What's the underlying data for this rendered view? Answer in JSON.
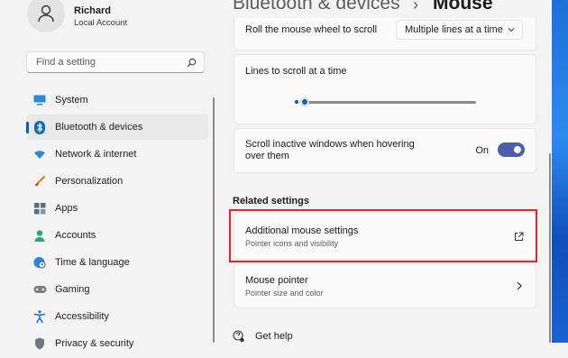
{
  "user": {
    "name": "Richard",
    "account_type": "Local Account"
  },
  "search": {
    "placeholder": "Find a setting",
    "icon": "search-icon"
  },
  "nav": [
    {
      "label": "System",
      "icon": "monitor-icon",
      "active": false
    },
    {
      "label": "Bluetooth & devices",
      "icon": "bluetooth-icon",
      "active": true
    },
    {
      "label": "Network & internet",
      "icon": "wifi-icon",
      "active": false
    },
    {
      "label": "Personalization",
      "icon": "brush-icon",
      "active": false
    },
    {
      "label": "Apps",
      "icon": "apps-icon",
      "active": false
    },
    {
      "label": "Accounts",
      "icon": "person-icon",
      "active": false
    },
    {
      "label": "Time & language",
      "icon": "globe-clock-icon",
      "active": false
    },
    {
      "label": "Gaming",
      "icon": "gamepad-icon",
      "active": false
    },
    {
      "label": "Accessibility",
      "icon": "accessibility-icon",
      "active": false
    },
    {
      "label": "Privacy & security",
      "icon": "shield-icon",
      "active": false
    }
  ],
  "breadcrumb": {
    "parent": "Bluetooth & devices",
    "separator": "›",
    "current": "Mouse"
  },
  "settings": {
    "scroll_wheel": {
      "label": "Roll the mouse wheel to scroll",
      "value": "Multiple lines at a time"
    },
    "lines_to_scroll": {
      "label": "Lines to scroll at a time",
      "level_fraction": 0.03
    },
    "scroll_inactive": {
      "label_line1": "Scroll inactive windows when hovering",
      "label_line2": "over them",
      "state": "On"
    }
  },
  "related": {
    "title": "Related settings",
    "additional": {
      "label": "Additional mouse settings",
      "sub": "Pointer icons and visibility",
      "icon": "open-external-icon"
    },
    "pointer": {
      "label": "Mouse pointer",
      "sub": "Pointer size and color",
      "icon": "chevron-right-icon"
    }
  },
  "help": {
    "label": "Get help",
    "icon": "help-icon"
  },
  "colors": {
    "accent": "#005fb8",
    "toggle_on": "#4a5fa8",
    "highlight_box": "#e0262e"
  }
}
